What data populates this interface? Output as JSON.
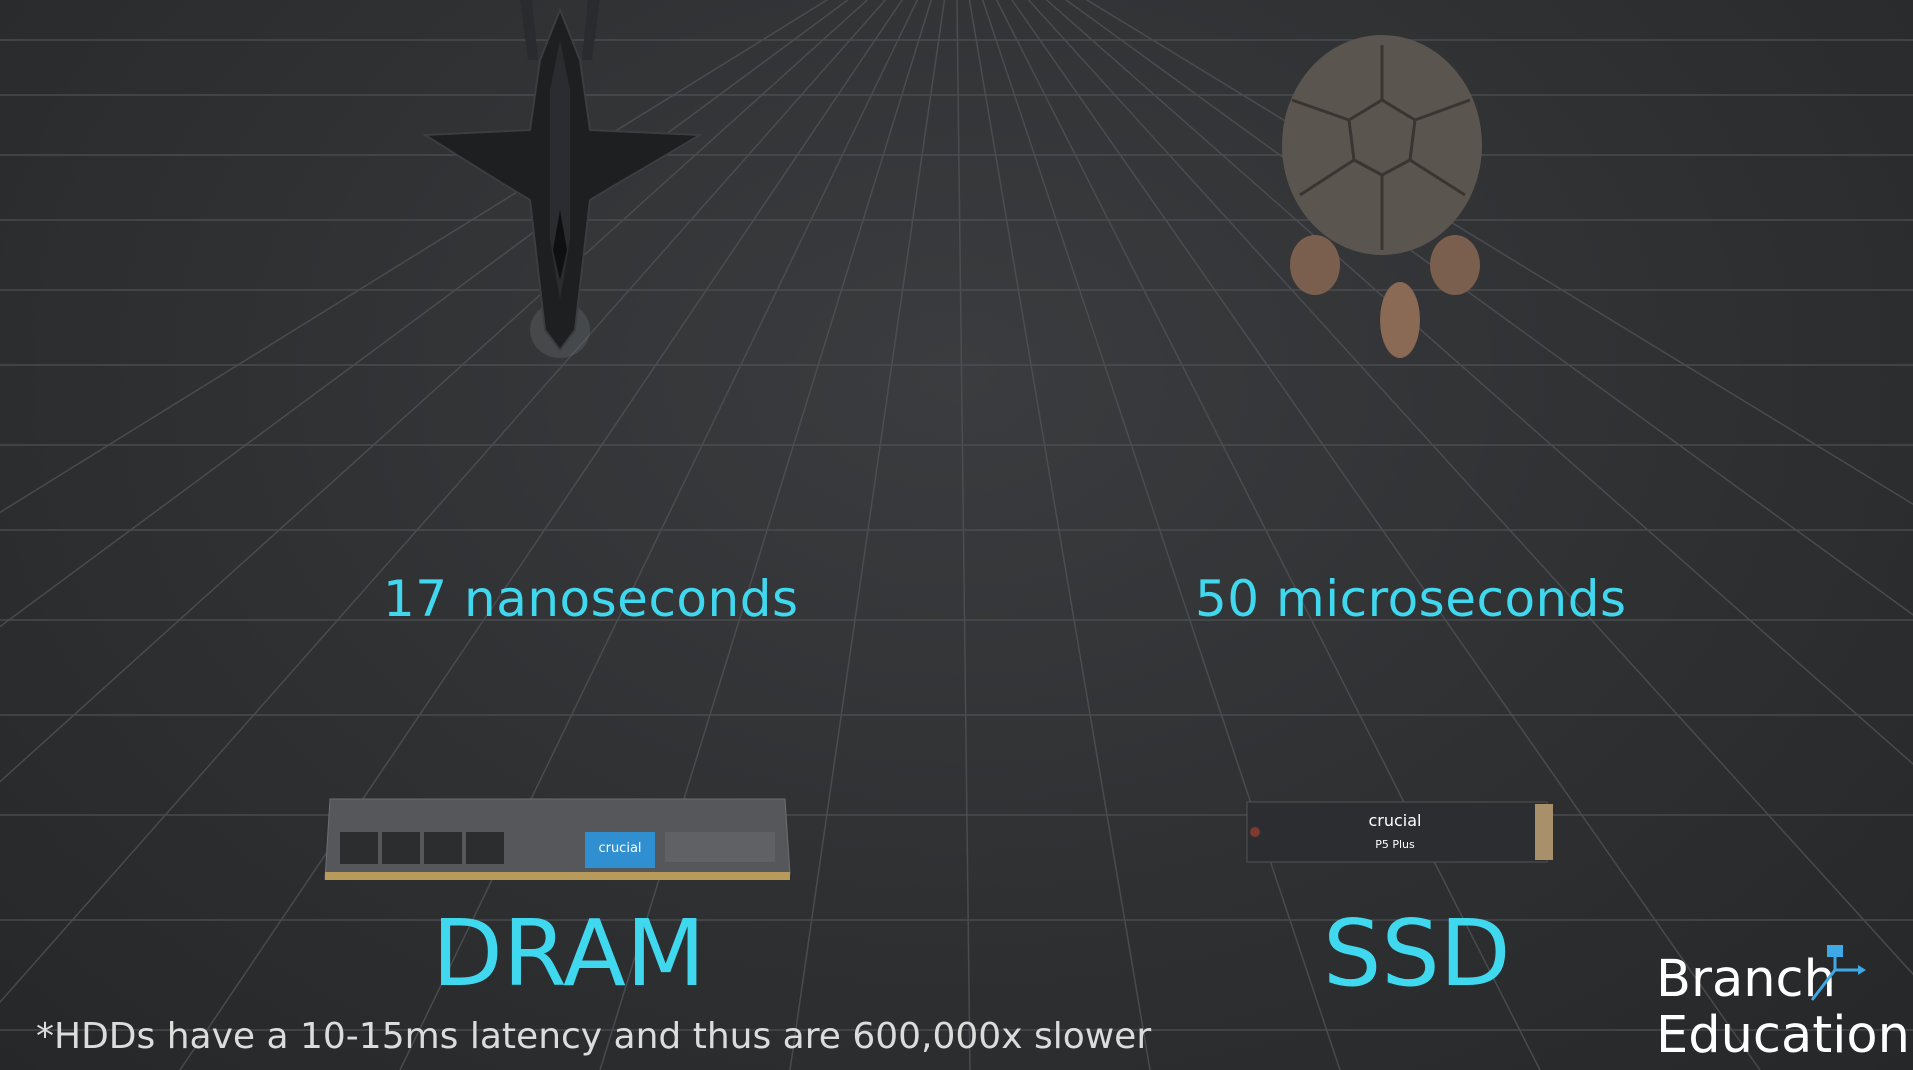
{
  "scene": {
    "left": {
      "latency": "17 nanoseconds",
      "component": "DRAM",
      "object_icon": "jet-icon",
      "chip_brand": "crucial"
    },
    "right": {
      "latency": "50 microseconds",
      "component": "SSD",
      "object_icon": "tortoise-icon",
      "chip_brand": "crucial",
      "chip_model": "P5 Plus"
    },
    "footnote": "*HDDs have a 10-15ms latency and thus are 600,000x slower"
  },
  "brand": {
    "line1": "Branch",
    "line2": "Education"
  },
  "colors": {
    "accent": "#3fd8ee",
    "background": "#2f3133",
    "grid": "#4a4c50",
    "text": "#dcdcdc"
  }
}
